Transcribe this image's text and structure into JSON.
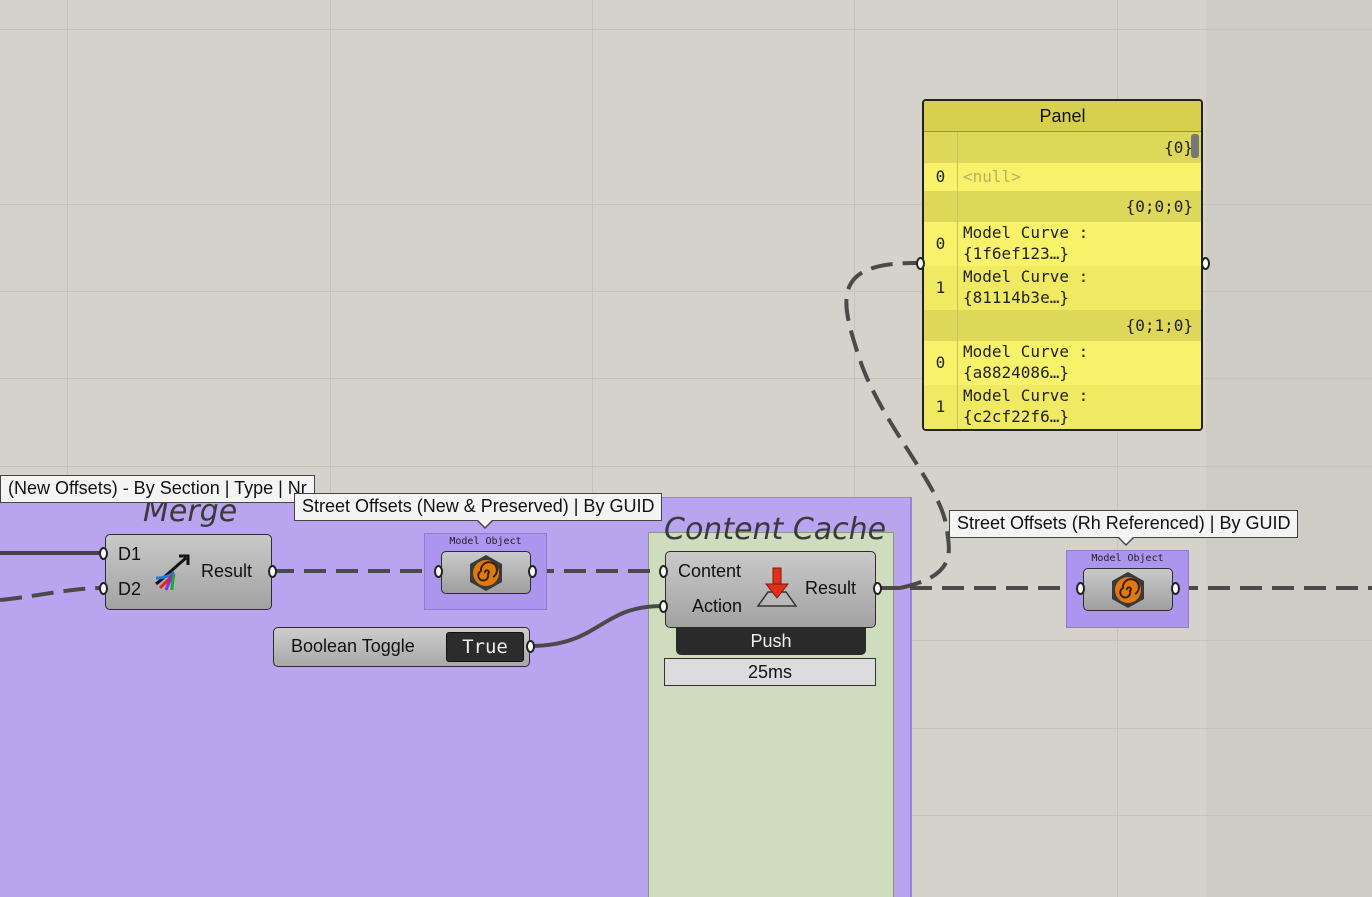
{
  "canvas": {
    "colors": {
      "background": "#d5d2cc",
      "group_purple": "#b8a4ef",
      "group_green": "#cfdcbd",
      "panel_yellow": "#f6f070"
    }
  },
  "groups": {
    "merge_title": "Merge",
    "cache_title": "Content Cache"
  },
  "tooltips": {
    "section": "(New Offsets) - By Section | Type | Nr",
    "preserved": "Street Offsets (New & Preserved) | By GUID",
    "referenced": "Street Offsets (Rh Referenced) | By GUID"
  },
  "merge": {
    "input_1": "D1",
    "input_2": "D2",
    "output": "Result",
    "icon": "merge-icon"
  },
  "model_object_1": {
    "label": "Model Object",
    "icon": "model-object-icon"
  },
  "model_object_2": {
    "label": "Model Object",
    "icon": "model-object-icon"
  },
  "boolean_toggle": {
    "label": "Boolean Toggle",
    "value": "True"
  },
  "content_cache": {
    "input_1": "Content",
    "input_2": "Action",
    "output": "Result",
    "icon": "content-cache-icon",
    "action_label": "Push",
    "timing": "25ms"
  },
  "panel": {
    "title": "Panel",
    "branches": [
      {
        "path": "{0}",
        "items": [
          {
            "index": "0",
            "lines": [
              "<null>"
            ]
          }
        ]
      },
      {
        "path": "{0;0;0}",
        "items": [
          {
            "index": "0",
            "lines": [
              "Model Curve :",
              "{1f6ef123…}"
            ]
          },
          {
            "index": "1",
            "lines": [
              "Model Curve :",
              "{81114b3e…}"
            ]
          }
        ]
      },
      {
        "path": "{0;1;0}",
        "items": [
          {
            "index": "0",
            "lines": [
              "Model Curve :",
              "{a8824086…}"
            ]
          },
          {
            "index": "1",
            "lines": [
              "Model Curve :",
              "{c2cf22f6…}"
            ]
          }
        ]
      }
    ]
  }
}
